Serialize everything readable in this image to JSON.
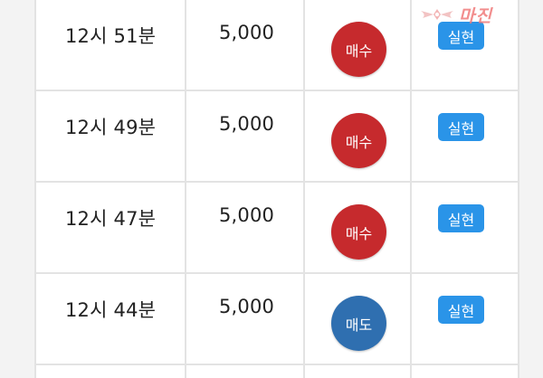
{
  "watermark": {
    "logo_text": "마진",
    "logo_color": "#f07b7b"
  },
  "colors": {
    "buy": "#c62a2d",
    "sell": "#2f6fb0",
    "status": "#2a94e8"
  },
  "rows": [
    {
      "time": "12시 51분",
      "amount": "5,000",
      "side": "매수",
      "status": "실현"
    },
    {
      "time": "12시 49분",
      "amount": "5,000",
      "side": "매수",
      "status": "실현"
    },
    {
      "time": "12시 47분",
      "amount": "5,000",
      "side": "매수",
      "status": "실현"
    },
    {
      "time": "12시 44분",
      "amount": "5,000",
      "side": "매도",
      "status": "실현"
    }
  ]
}
